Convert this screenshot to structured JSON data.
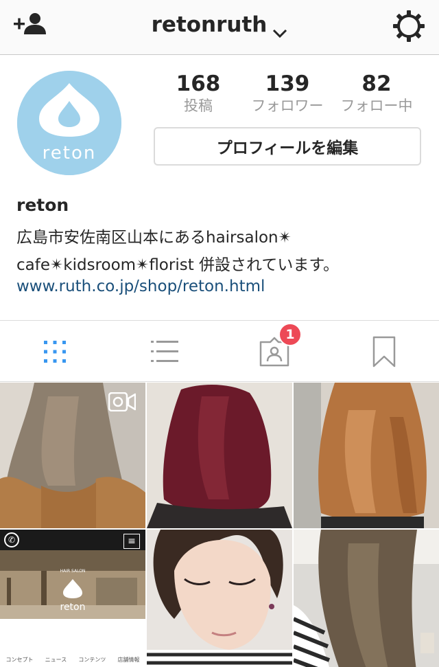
{
  "navbar": {
    "username": "retonruth",
    "add_icon": "add-person-icon",
    "settings_icon": "gear-icon",
    "dropdown_icon": "chevron-down-icon"
  },
  "profile": {
    "avatar_text": "reton",
    "stats": [
      {
        "value": "168",
        "label": "投稿"
      },
      {
        "value": "139",
        "label": "フォロワー"
      },
      {
        "value": "82",
        "label": "フォロー中"
      }
    ],
    "edit_button": "プロフィールを編集",
    "name": "reton",
    "bio_line1": "広島市安佐南区山本にあるhairsalon✴︎",
    "bio_line2": "cafe✴︎kidsroom✴︎florist 併設されています。",
    "website": "www.ruth.co.jp/shop/reton.html"
  },
  "tabs": {
    "items": [
      {
        "icon": "grid-icon",
        "active": true
      },
      {
        "icon": "list-icon",
        "active": false
      },
      {
        "icon": "tagged-photos-icon",
        "active": false,
        "badge": "1"
      },
      {
        "icon": "bookmark-icon",
        "active": false
      }
    ]
  },
  "grid": {
    "web_logo": "reton",
    "web_heading": "HAIR SALON",
    "web_menu": [
      "コンセプト",
      "ニュース",
      "コンテンツ",
      "店舗情報"
    ]
  },
  "colors": {
    "accent_blue": "#3897f0",
    "link_blue": "#1a4f7a",
    "badge_red": "#ed4956",
    "avatar_bg": "#9fd1eb"
  }
}
